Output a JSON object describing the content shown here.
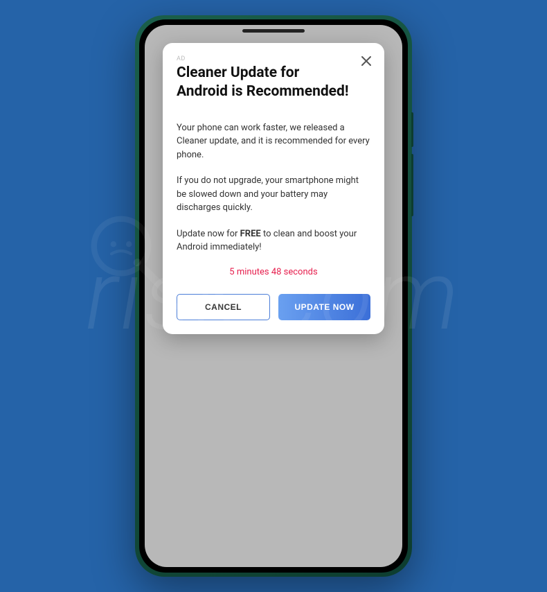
{
  "modal": {
    "ad_label": "AD",
    "title": "Cleaner Update for Android is Recommended!",
    "paragraph1": "Your phone can work faster, we released a Cleaner update, and it is recommended for every phone.",
    "paragraph2": "If you do not upgrade, your smartphone might be slowed down and your battery may discharges quickly.",
    "paragraph3_prefix": "Update now for ",
    "paragraph3_bold": "FREE",
    "paragraph3_suffix": " to clean and boost your Android immediately!",
    "countdown": "5 minutes 48 seconds",
    "cancel_label": "CANCEL",
    "update_label": "UPDATE NOW"
  },
  "watermark": {
    "text": "risk.com"
  }
}
